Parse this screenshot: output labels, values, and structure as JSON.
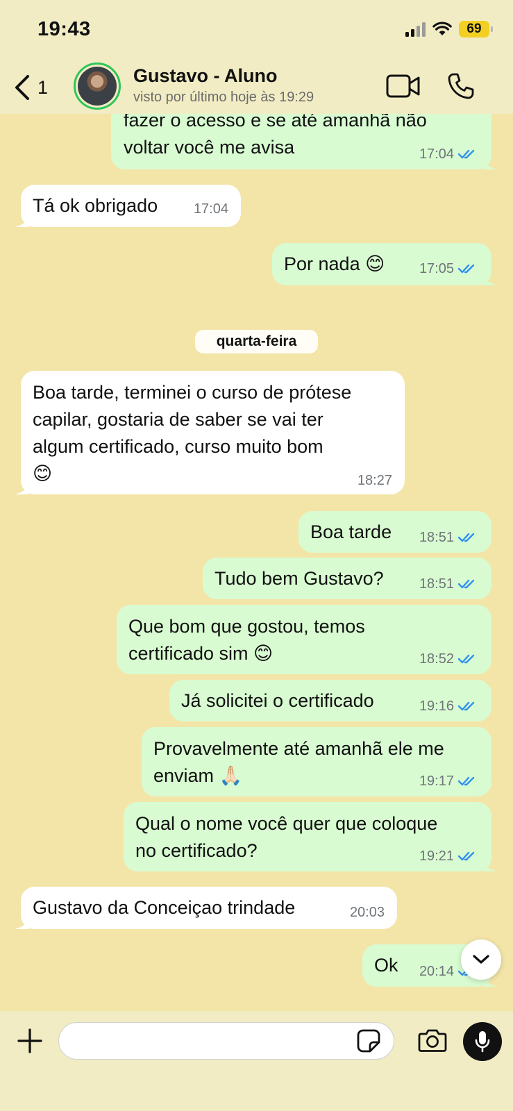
{
  "status_bar": {
    "time": "19:43",
    "battery": "69"
  },
  "header": {
    "back_count": "1",
    "contact_name": "Gustavo - Aluno",
    "contact_status": "visto por último hoje às 19:29"
  },
  "date_separator": "quarta-feira",
  "messages": [
    {
      "direction": "out",
      "lines": [
        "fazer o acesso e se até amanhã não",
        "voltar você me avisa"
      ],
      "time": "17:04",
      "read": true
    },
    {
      "direction": "in",
      "lines": [
        "Tá ok obrigado"
      ],
      "time": "17:04"
    },
    {
      "direction": "out",
      "lines": [
        "Por nada 😊"
      ],
      "time": "17:05",
      "read": true
    },
    {
      "direction": "in",
      "lines": [
        "Boa tarde, terminei o curso de prótese",
        "capilar, gostaria de saber se vai ter",
        "algum certificado, curso muito bom",
        "😊"
      ],
      "time": "18:27"
    },
    {
      "direction": "out",
      "lines": [
        "Boa tarde"
      ],
      "time": "18:51",
      "read": true
    },
    {
      "direction": "out",
      "lines": [
        "Tudo bem Gustavo?"
      ],
      "time": "18:51",
      "read": true
    },
    {
      "direction": "out",
      "lines": [
        "Que bom que gostou, temos",
        "certificado sim 😊"
      ],
      "time": "18:52",
      "read": true
    },
    {
      "direction": "out",
      "lines": [
        "Já solicitei o certificado"
      ],
      "time": "19:16",
      "read": true
    },
    {
      "direction": "out",
      "lines": [
        "Provavelmente até amanhã ele me",
        "enviam 🙏🏻"
      ],
      "time": "19:17",
      "read": true
    },
    {
      "direction": "out",
      "lines": [
        "Qual o nome você quer que coloque",
        "no certificado?"
      ],
      "time": "19:21",
      "read": true
    },
    {
      "direction": "in",
      "lines": [
        "Gustavo da Conceiçao trindade"
      ],
      "time": "20:03"
    },
    {
      "direction": "out",
      "lines": [
        "Ok"
      ],
      "time": "20:14",
      "read": true
    }
  ],
  "composer": {
    "input_value": ""
  },
  "colors": {
    "wallpaper": "#f3e5a8",
    "outgoing_bubble": "#d8fbd1",
    "incoming_bubble": "#ffffff",
    "read_tick": "#2f8ff0",
    "online_ring": "#2fc55a"
  }
}
